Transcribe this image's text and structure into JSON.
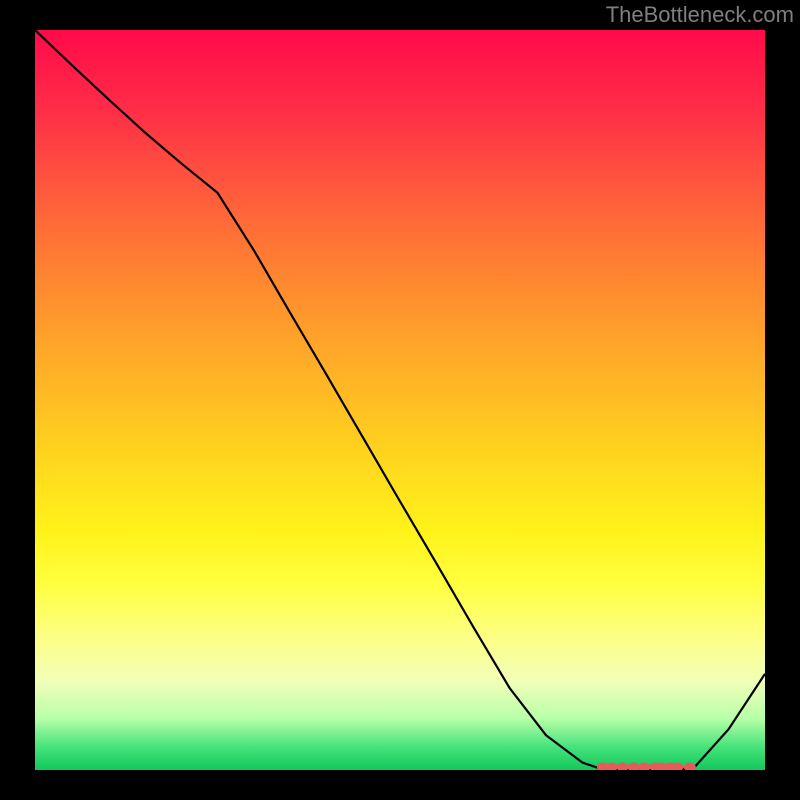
{
  "attribution": "TheBottleneck.com",
  "chart_data": {
    "type": "line",
    "x": [
      0.0,
      0.05,
      0.1,
      0.15,
      0.2,
      0.25,
      0.3,
      0.35,
      0.4,
      0.45,
      0.5,
      0.55,
      0.6,
      0.65,
      0.7,
      0.75,
      0.78,
      0.8,
      0.825,
      0.85,
      0.875,
      0.9,
      0.95,
      1.0
    ],
    "y": [
      1.0,
      0.953,
      0.907,
      0.862,
      0.82,
      0.78,
      0.702,
      0.617,
      0.533,
      0.448,
      0.363,
      0.279,
      0.194,
      0.111,
      0.047,
      0.01,
      0.0,
      0.0,
      0.003,
      0.0,
      0.003,
      0.0,
      0.055,
      0.13
    ],
    "markers": {
      "x": [
        0.778,
        0.79,
        0.805,
        0.82,
        0.835,
        0.85,
        0.858,
        0.87,
        0.88,
        0.897
      ],
      "y": [
        0.004,
        0.004,
        0.004,
        0.004,
        0.004,
        0.004,
        0.004,
        0.004,
        0.004,
        0.004
      ]
    },
    "title": "",
    "xlabel": "",
    "ylabel": "",
    "xlim": [
      0,
      1
    ],
    "ylim": [
      0,
      1
    ]
  },
  "chart": {
    "marker_color": "#e85a5a",
    "line_color": "#000000"
  }
}
